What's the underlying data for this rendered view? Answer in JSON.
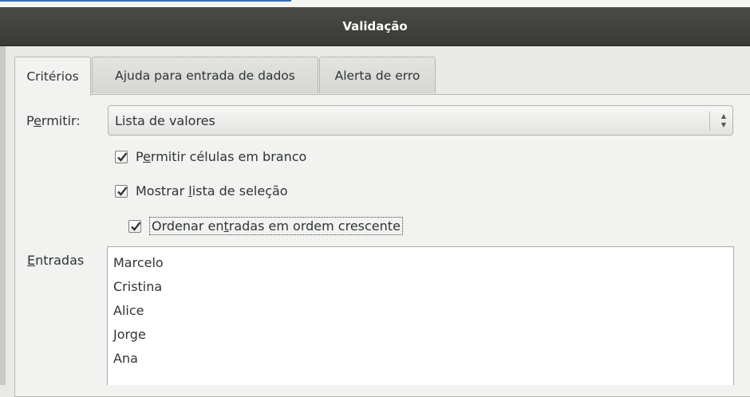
{
  "window": {
    "title": "Validação"
  },
  "tabs": [
    {
      "label": "Critérios",
      "active": true
    },
    {
      "label": "Ajuda para entrada de dados",
      "active": false
    },
    {
      "label": "Alerta de erro",
      "active": false
    }
  ],
  "criteria": {
    "allow_label_pre": "P",
    "allow_label_mnemonic": "e",
    "allow_label_post": "rmitir:",
    "allow_value": "Lista de valores",
    "checkboxes": [
      {
        "pre": "P",
        "mnemonic": "e",
        "post": "rmitir células em branco",
        "checked": true
      },
      {
        "pre": "Mostrar ",
        "mnemonic": "l",
        "post": "ista de seleção",
        "checked": true
      },
      {
        "pre": "Ordenar en",
        "mnemonic": "t",
        "post": "radas em ordem crescente",
        "checked": true
      }
    ],
    "entries_label_mnemonic": "E",
    "entries_label_post": "ntradas",
    "entries": [
      "Marcelo",
      "Cristina",
      "Alice",
      "Jorge",
      "Ana"
    ]
  },
  "colors": {
    "titlebar": "#3f3f3c",
    "check": "#2e3436"
  }
}
